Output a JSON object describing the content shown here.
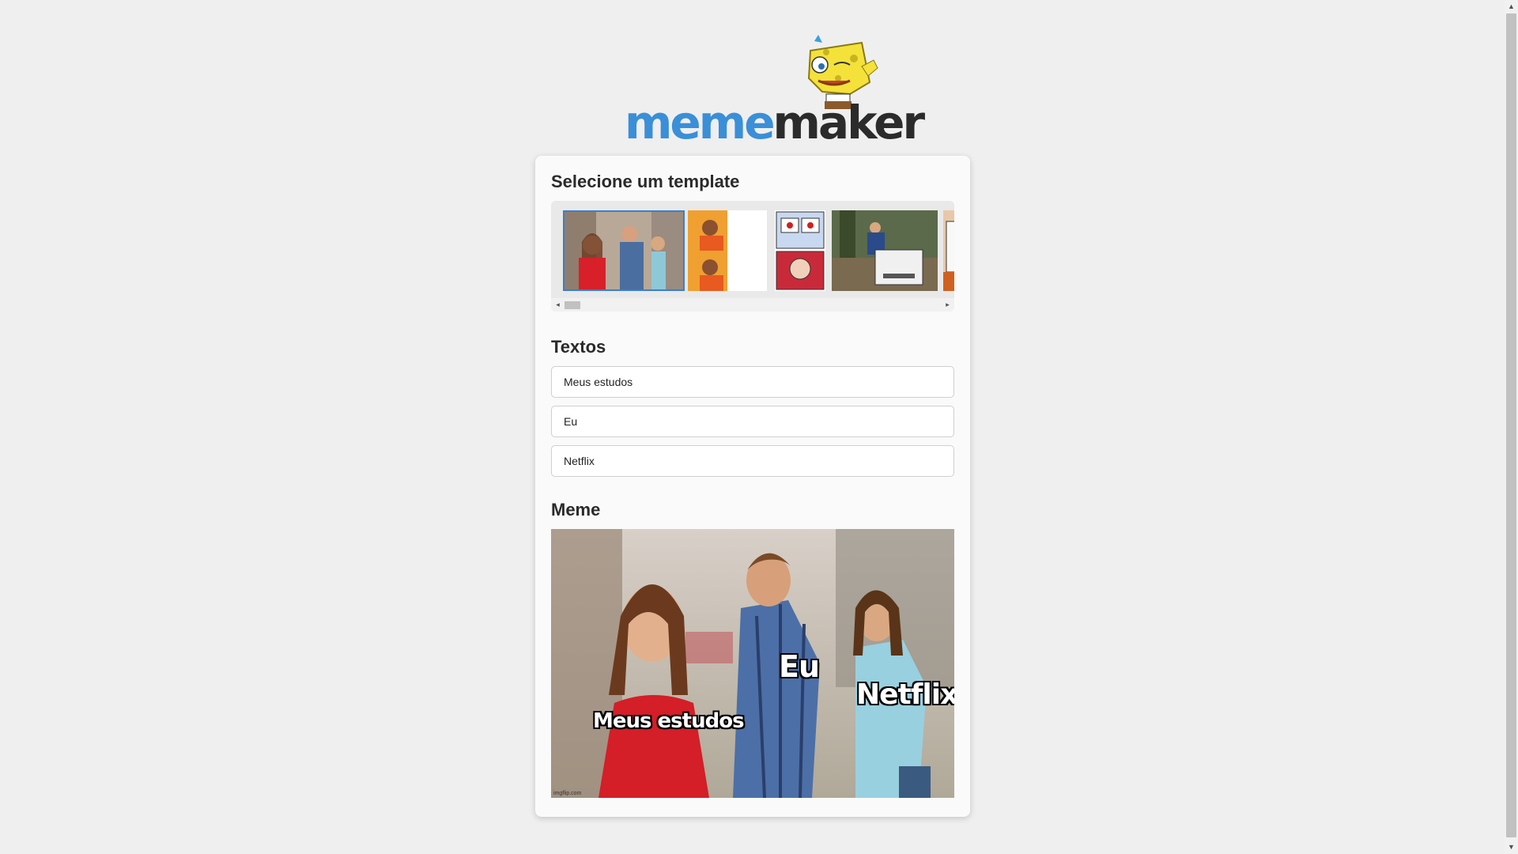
{
  "app": {
    "logo_primary": "meme",
    "logo_secondary": "maker",
    "brand_color": "#3a8fd8"
  },
  "templates": {
    "heading": "Selecione um template",
    "items": [
      {
        "name": "distracted-boyfriend",
        "selected": true
      },
      {
        "name": "drake-hotline-bling",
        "selected": false
      },
      {
        "name": "daily-struggle",
        "selected": false
      },
      {
        "name": "change-my-mind",
        "selected": false
      },
      {
        "name": "uno-draw-25",
        "selected": false
      }
    ]
  },
  "texts": {
    "heading": "Textos",
    "fields": [
      "Meus estudos",
      "Eu",
      "Netflix"
    ]
  },
  "meme": {
    "heading": "Meme",
    "captions": [
      "Meus estudos",
      "Eu",
      "Netflix"
    ],
    "watermark": "imgflip.com"
  },
  "icons": [
    "mascot-icon",
    "scroll-up-arrow-icon",
    "scroll-down-arrow-icon",
    "scroll-left-arrow-icon",
    "scroll-right-arrow-icon"
  ]
}
